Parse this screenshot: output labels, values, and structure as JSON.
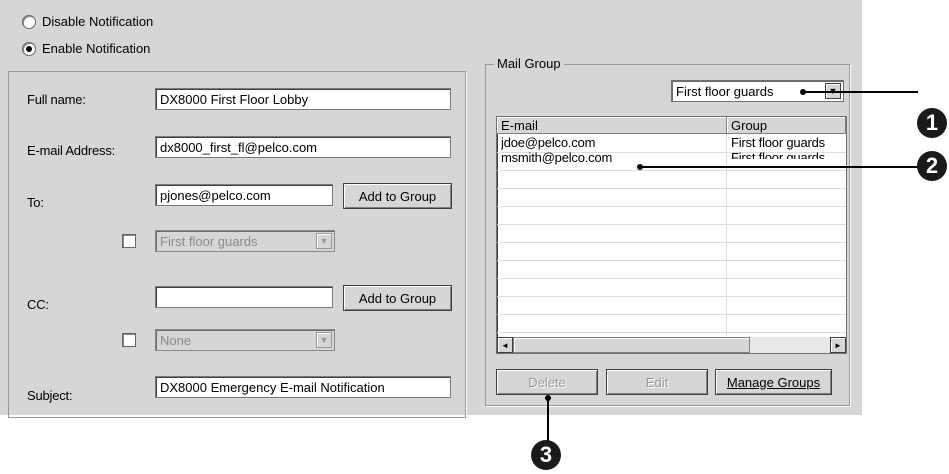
{
  "notification": {
    "disable_label": "Disable Notification",
    "enable_label": "Enable Notification",
    "selected": "enable"
  },
  "form": {
    "full_name_label": "Full name:",
    "full_name_value": "DX8000 First Floor Lobby",
    "email_label": "E-mail Address:",
    "email_value": "dx8000_first_fl@pelco.com",
    "to_label": "To:",
    "to_value": "pjones@pelco.com",
    "to_add_button": "Add to Group",
    "to_group_select": "First floor guards",
    "cc_label": "CC:",
    "cc_value": "",
    "cc_add_button": "Add to Group",
    "cc_group_select": "None",
    "subject_label": "Subject:",
    "subject_value": "DX8000 Emergency E-mail Notification"
  },
  "mail_group": {
    "title": "Mail Group",
    "group_select": "First floor guards",
    "columns": [
      "E-mail",
      "Group"
    ],
    "rows": [
      {
        "email": "jdoe@pelco.com",
        "group": "First floor guards"
      },
      {
        "email": "msmith@pelco.com",
        "group": "First floor guards"
      }
    ],
    "delete_button": "Delete",
    "edit_button": "Edit",
    "manage_button": "Manage Groups"
  },
  "callouts": [
    "1",
    "2",
    "3"
  ],
  "icons": {
    "scroll_left": "◄",
    "scroll_right": "►",
    "dropdown": "▼"
  }
}
